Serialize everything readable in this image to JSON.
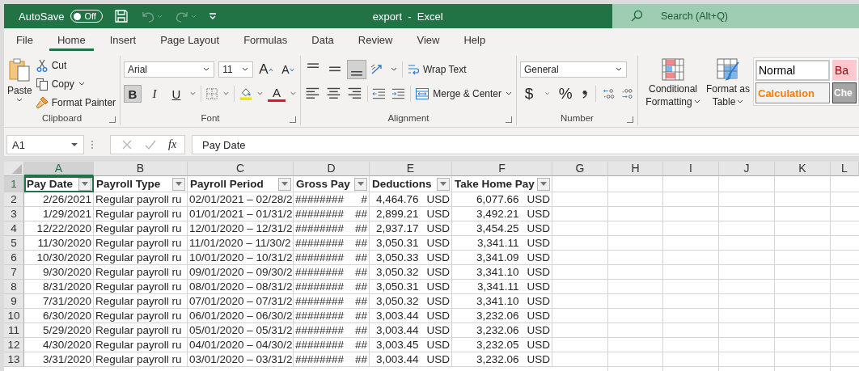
{
  "title_bar": {
    "autosave_label": "AutoSave",
    "autosave": {
      "on": false,
      "label": "Off"
    },
    "title": "export  -  Excel",
    "search": {
      "placeholder": "Search (Alt+Q)"
    }
  },
  "tabs": [
    {
      "label": "File",
      "selected": false
    },
    {
      "label": "Home",
      "selected": true
    },
    {
      "label": "Insert",
      "selected": false
    },
    {
      "label": "Page Layout",
      "selected": false
    },
    {
      "label": "Formulas",
      "selected": false
    },
    {
      "label": "Data",
      "selected": false
    },
    {
      "label": "Review",
      "selected": false
    },
    {
      "label": "View",
      "selected": false
    },
    {
      "label": "Help",
      "selected": false
    }
  ],
  "ribbon": {
    "clipboard": {
      "paste": "Paste",
      "cut": "Cut",
      "copy": "Copy",
      "format_painter": "Format Painter",
      "label": "Clipboard"
    },
    "font": {
      "font_name": "Arial",
      "font_size": "11",
      "grow": "A",
      "shrink": "A",
      "styles": [
        {
          "kind": "bold",
          "label": "B",
          "selected": true
        },
        {
          "kind": "italic",
          "label": "I",
          "selected": false
        },
        {
          "kind": "underline",
          "label": "U",
          "selected": false
        }
      ],
      "font_color": "A",
      "label": "Font"
    },
    "alignment": {
      "vertical": [
        {
          "kind": "top",
          "selected": false
        },
        {
          "kind": "middle",
          "selected": false
        },
        {
          "kind": "bottom",
          "selected": true
        }
      ],
      "horizontal": [
        {
          "kind": "left",
          "selected": false
        },
        {
          "kind": "center",
          "selected": false
        },
        {
          "kind": "right",
          "selected": false
        }
      ],
      "wrap_text": "Wrap Text",
      "merge": "Merge & Center",
      "label": "Alignment"
    },
    "number": {
      "format": "General",
      "currency": "$",
      "percent": "%",
      "label": "Number"
    },
    "styles": {
      "conditional": [
        "Conditional",
        "Formatting"
      ],
      "format_table": [
        "Format as",
        "Table"
      ],
      "cells": [
        {
          "kind": "normal",
          "label": "Normal"
        },
        {
          "kind": "bad",
          "label": "Ba"
        },
        {
          "kind": "calculation",
          "label": "Calculation"
        },
        {
          "kind": "check",
          "label": "Che"
        }
      ]
    }
  },
  "formula_bar": {
    "name_box": "A1",
    "function_label": "fx",
    "formula": "Pay Date"
  },
  "sheet": {
    "columns": [
      {
        "label": "A",
        "selected": true
      },
      {
        "label": "B",
        "selected": false
      },
      {
        "label": "C",
        "selected": false
      },
      {
        "label": "D",
        "selected": false
      },
      {
        "label": "E",
        "selected": false
      },
      {
        "label": "F",
        "selected": false
      },
      {
        "label": "G",
        "selected": false
      },
      {
        "label": "H",
        "selected": false
      },
      {
        "label": "I",
        "selected": false
      },
      {
        "label": "J",
        "selected": false
      },
      {
        "label": "K",
        "selected": false
      },
      {
        "label": "L",
        "selected": false
      }
    ],
    "header_row": {
      "number": "1",
      "cells": [
        {
          "label": "Pay Date",
          "selected": true
        },
        {
          "label": "Payroll Type",
          "selected": false
        },
        {
          "label": "Payroll Period",
          "selected": false
        },
        {
          "label": "Gross Pay",
          "selected": false
        },
        {
          "label": "Deductions",
          "selected": false
        },
        {
          "label": "Take Home Pay",
          "selected": false
        }
      ]
    },
    "rows": [
      {
        "number": "2",
        "pay_date": "2/26/2021",
        "payroll_type": "Regular payroll ru",
        "period": "02/01/2021 – 02/28/2",
        "gross": "########",
        "gross_suffix": "#",
        "deductions": "4,464.76",
        "deductions_currency": "USD",
        "take_home": "6,077.66",
        "take_home_currency": "USD"
      },
      {
        "number": "3",
        "pay_date": "1/29/2021",
        "payroll_type": "Regular payroll ru",
        "period": "01/01/2021 – 01/31/2",
        "gross": "########",
        "gross_suffix": "##",
        "deductions": "2,899.21",
        "deductions_currency": "USD",
        "take_home": "3,492.21",
        "take_home_currency": "USD"
      },
      {
        "number": "4",
        "pay_date": "12/22/2020",
        "payroll_type": "Regular payroll ru",
        "period": "12/01/2020 – 12/31/2",
        "gross": "########",
        "gross_suffix": "##",
        "deductions": "2,937.17",
        "deductions_currency": "USD",
        "take_home": "3,454.25",
        "take_home_currency": "USD"
      },
      {
        "number": "5",
        "pay_date": "11/30/2020",
        "payroll_type": "Regular payroll ru",
        "period": "11/01/2020 – 11/30/2",
        "gross": "########",
        "gross_suffix": "##",
        "deductions": "3,050.31",
        "deductions_currency": "USD",
        "take_home": "3,341.11",
        "take_home_currency": "USD"
      },
      {
        "number": "6",
        "pay_date": "10/30/2020",
        "payroll_type": "Regular payroll ru",
        "period": "10/01/2020 – 10/31/2",
        "gross": "########",
        "gross_suffix": "##",
        "deductions": "3,050.33",
        "deductions_currency": "USD",
        "take_home": "3,341.09",
        "take_home_currency": "USD"
      },
      {
        "number": "7",
        "pay_date": "9/30/2020",
        "payroll_type": "Regular payroll ru",
        "period": "09/01/2020 – 09/30/2",
        "gross": "########",
        "gross_suffix": "##",
        "deductions": "3,050.32",
        "deductions_currency": "USD",
        "take_home": "3,341.10",
        "take_home_currency": "USD"
      },
      {
        "number": "8",
        "pay_date": "8/31/2020",
        "payroll_type": "Regular payroll ru",
        "period": "08/01/2020 – 08/31/2",
        "gross": "########",
        "gross_suffix": "##",
        "deductions": "3,050.31",
        "deductions_currency": "USD",
        "take_home": "3,341.11",
        "take_home_currency": "USD"
      },
      {
        "number": "9",
        "pay_date": "7/31/2020",
        "payroll_type": "Regular payroll ru",
        "period": "07/01/2020 – 07/31/2",
        "gross": "########",
        "gross_suffix": "##",
        "deductions": "3,050.32",
        "deductions_currency": "USD",
        "take_home": "3,341.10",
        "take_home_currency": "USD"
      },
      {
        "number": "10",
        "pay_date": "6/30/2020",
        "payroll_type": "Regular payroll ru",
        "period": "06/01/2020 – 06/30/2",
        "gross": "########",
        "gross_suffix": "##",
        "deductions": "3,003.44",
        "deductions_currency": "USD",
        "take_home": "3,232.06",
        "take_home_currency": "USD"
      },
      {
        "number": "11",
        "pay_date": "5/29/2020",
        "payroll_type": "Regular payroll ru",
        "period": "05/01/2020 – 05/31/2",
        "gross": "########",
        "gross_suffix": "##",
        "deductions": "3,003.44",
        "deductions_currency": "USD",
        "take_home": "3,232.06",
        "take_home_currency": "USD"
      },
      {
        "number": "12",
        "pay_date": "4/30/2020",
        "payroll_type": "Regular payroll ru",
        "period": "04/01/2020 – 04/30/2",
        "gross": "########",
        "gross_suffix": "##",
        "deductions": "3,003.45",
        "deductions_currency": "USD",
        "take_home": "3,232.05",
        "take_home_currency": "USD"
      },
      {
        "number": "13",
        "pay_date": "3/31/2020",
        "payroll_type": "Regular payroll ru",
        "period": "03/01/2020 – 03/31/2",
        "gross": "########",
        "gross_suffix": "##",
        "deductions": "3,003.44",
        "deductions_currency": "USD",
        "take_home": "3,232.06",
        "take_home_currency": "USD"
      }
    ]
  }
}
